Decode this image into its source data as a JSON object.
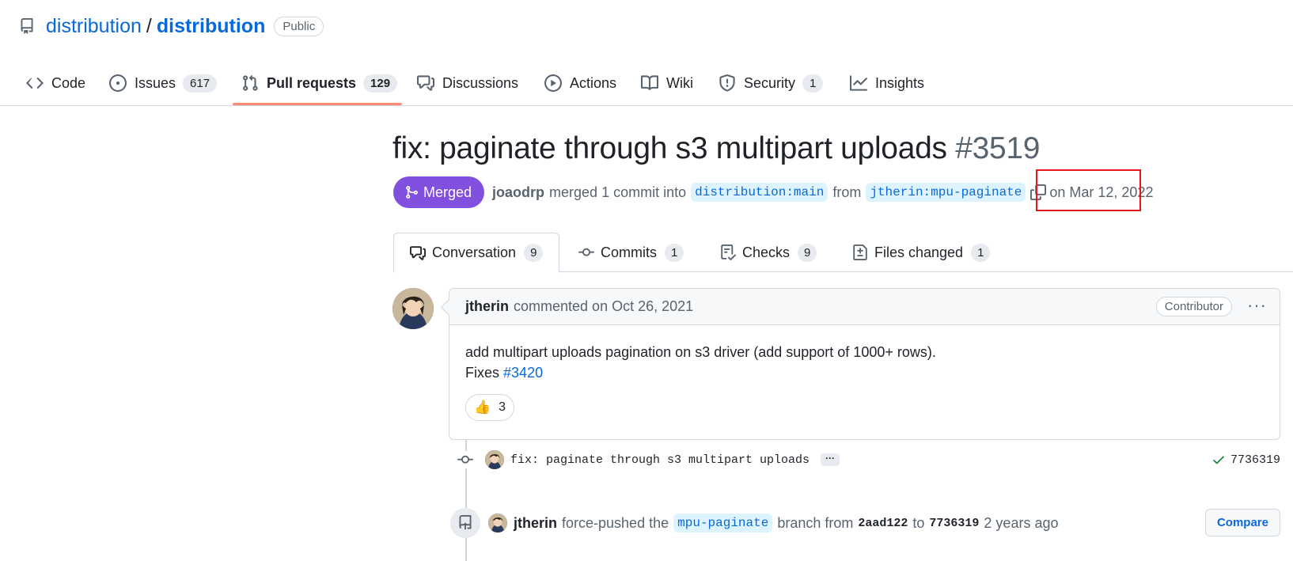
{
  "repo": {
    "owner": "distribution",
    "separator": "/",
    "name": "distribution",
    "visibility": "Public"
  },
  "nav": {
    "items": [
      {
        "label": "Code",
        "icon": "code-icon"
      },
      {
        "label": "Issues",
        "count": "617",
        "icon": "issue-icon"
      },
      {
        "label": "Pull requests",
        "count": "129",
        "icon": "pull-request-icon",
        "active": true
      },
      {
        "label": "Discussions",
        "icon": "discussions-icon"
      },
      {
        "label": "Actions",
        "icon": "play-icon"
      },
      {
        "label": "Wiki",
        "icon": "book-icon"
      },
      {
        "label": "Security",
        "count": "1",
        "icon": "shield-icon"
      },
      {
        "label": "Insights",
        "icon": "graph-icon"
      }
    ]
  },
  "pr": {
    "title": "fix: paginate through s3 multipart uploads",
    "number": "#3519",
    "state": "Merged",
    "author": "joaodrp",
    "merge_text": "merged 1 commit into",
    "base_branch": "distribution:main",
    "from_text": "from",
    "head_branch": "jtherin:mpu-paginate",
    "date_text": "on Mar 12, 2022"
  },
  "tabs": [
    {
      "label": "Conversation",
      "count": "9"
    },
    {
      "label": "Commits",
      "count": "1"
    },
    {
      "label": "Checks",
      "count": "9"
    },
    {
      "label": "Files changed",
      "count": "1"
    }
  ],
  "comment": {
    "author": "jtherin",
    "time_text": "commented on Oct 26, 2021",
    "role": "Contributor",
    "menu": "···",
    "body_line1": "add multipart uploads pagination on s3 driver (add support of 1000+ rows).",
    "fixes_prefix": "Fixes",
    "fixes_link": "#3420",
    "reaction_emoji": "👍",
    "reaction_count": "3"
  },
  "timeline": {
    "commit_message": "fix: paginate through s3 multipart uploads",
    "commit_more": "···",
    "commit_sha": "7736319",
    "push_author": "jtherin",
    "push_text1": "force-pushed the",
    "push_branch": "mpu-paginate",
    "push_text2": "branch from",
    "push_from_sha": "2aad122",
    "push_text3": "to",
    "push_to_sha": "7736319",
    "push_time": "2 years ago",
    "compare_label": "Compare"
  },
  "colors": {
    "accent": "#0969da",
    "merged": "#8250df",
    "nav_underline": "#fd8c73",
    "highlight": "#e5181e",
    "success": "#1a7f37"
  }
}
